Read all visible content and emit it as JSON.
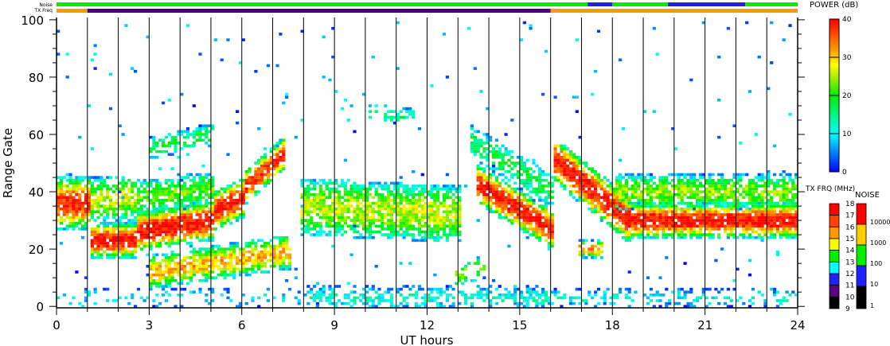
{
  "top_bars": {
    "noise_label": "Noise",
    "txfreq_label": "TX Freq",
    "noise_segments": [
      {
        "from": 0,
        "to": 17.2,
        "color": "#00ee00"
      },
      {
        "from": 17.2,
        "to": 18.0,
        "color": "#2020e0"
      },
      {
        "from": 18.0,
        "to": 19.8,
        "color": "#00ee00"
      },
      {
        "from": 19.8,
        "to": 22.3,
        "color": "#2020e0"
      },
      {
        "from": 22.3,
        "to": 24,
        "color": "#00ee00"
      }
    ],
    "txfreq_segments": [
      {
        "from": 0,
        "to": 1,
        "color": "#ff9900"
      },
      {
        "from": 1,
        "to": 16,
        "color": "#4b0082"
      },
      {
        "from": 16,
        "to": 24,
        "color": "#ff9900"
      }
    ]
  },
  "chart_data": {
    "type": "heatmap",
    "title": "",
    "xlabel": "UT hours",
    "ylabel": "Range Gate",
    "xlim": [
      0,
      24
    ],
    "ylim": [
      -0.5,
      100.8
    ],
    "xticks": [
      "0",
      "3",
      "6",
      "9",
      "12",
      "15",
      "18",
      "21",
      "24"
    ],
    "xtick_values": [
      0,
      3,
      6,
      9,
      12,
      15,
      18,
      21,
      24
    ],
    "yticks": [
      "0",
      "20",
      "40",
      "60",
      "80",
      "100"
    ],
    "ytick_values": [
      0,
      20,
      40,
      60,
      80,
      100
    ],
    "vertical_grid_hours": [
      1,
      2,
      3,
      4,
      5,
      6,
      7,
      8,
      9,
      10,
      11,
      12,
      13,
      14,
      15,
      16,
      17,
      18,
      19,
      20,
      21,
      22,
      23
    ],
    "value_label": "POWER (dB)",
    "value_range": [
      0,
      40
    ],
    "echo_regions": [
      {
        "hours": [
          0,
          1
        ],
        "gate_center": [
          36,
          36
        ],
        "half_width": 9,
        "peak_db": 38,
        "density": 0.95
      },
      {
        "hours": [
          1,
          2.6
        ],
        "gate_center": [
          23,
          23
        ],
        "half_width": 6,
        "peak_db": 40,
        "density": 0.95
      },
      {
        "hours": [
          1,
          2.6
        ],
        "gate_center": [
          37,
          38
        ],
        "half_width": 8,
        "peak_db": 26,
        "density": 0.8
      },
      {
        "hours": [
          2.6,
          5
        ],
        "gate_center": [
          26,
          30
        ],
        "half_width": 7,
        "peak_db": 40,
        "density": 0.95
      },
      {
        "hours": [
          2.6,
          5
        ],
        "gate_center": [
          38,
          41
        ],
        "half_width": 6,
        "peak_db": 22,
        "density": 0.8
      },
      {
        "hours": [
          5,
          6
        ],
        "gate_center": [
          33,
          38
        ],
        "half_width": 7,
        "peak_db": 39,
        "density": 0.95
      },
      {
        "hours": [
          6,
          7.3
        ],
        "gate_center": [
          41,
          53
        ],
        "half_width": 6,
        "peak_db": 38,
        "density": 0.9
      },
      {
        "hours": [
          3,
          7.5
        ],
        "gate_center": [
          12,
          19
        ],
        "half_width": 6,
        "peak_db": 31,
        "density": 0.85
      },
      {
        "hours": [
          3,
          5
        ],
        "gate_center": [
          55,
          60
        ],
        "half_width": 4,
        "peak_db": 18,
        "density": 0.55
      },
      {
        "hours": [
          7.8,
          13
        ],
        "gate_center": [
          35,
          32
        ],
        "half_width": 10,
        "peak_db": 26,
        "density": 0.85
      },
      {
        "hours": [
          10,
          11.5
        ],
        "gate_center": [
          68,
          66
        ],
        "half_width": 3,
        "peak_db": 15,
        "density": 0.4
      },
      {
        "hours": [
          12.8,
          13.8
        ],
        "gate_center": [
          10,
          14
        ],
        "half_width": 4,
        "peak_db": 24,
        "density": 0.5
      },
      {
        "hours": [
          13.5,
          16
        ],
        "gate_center": [
          43,
          27
        ],
        "half_width": 7,
        "peak_db": 40,
        "density": 0.95
      },
      {
        "hours": [
          13.3,
          16
        ],
        "gate_center": [
          58,
          40
        ],
        "half_width": 6,
        "peak_db": 18,
        "density": 0.7
      },
      {
        "hours": [
          16,
          18.5
        ],
        "gate_center": [
          52,
          30
        ],
        "half_width": 8,
        "peak_db": 40,
        "density": 0.95
      },
      {
        "hours": [
          16.8,
          17.6
        ],
        "gate_center": [
          20,
          20
        ],
        "half_width": 3,
        "peak_db": 32,
        "density": 0.8
      },
      {
        "hours": [
          18.5,
          24
        ],
        "gate_center": [
          30,
          30
        ],
        "half_width": 6,
        "peak_db": 40,
        "density": 0.95
      },
      {
        "hours": [
          18,
          24
        ],
        "gate_center": [
          40,
          40
        ],
        "half_width": 6,
        "peak_db": 24,
        "density": 0.85
      },
      {
        "hours": [
          8,
          16
        ],
        "gate_center": [
          3,
          3
        ],
        "half_width": 4,
        "peak_db": 12,
        "density": 0.5
      },
      {
        "hours": [
          16,
          24
        ],
        "gate_center": [
          3,
          3
        ],
        "half_width": 3,
        "peak_db": 11,
        "density": 0.3
      },
      {
        "hours": [
          0,
          8
        ],
        "gate_center": [
          3,
          3
        ],
        "half_width": 3,
        "peak_db": 10,
        "density": 0.2
      }
    ],
    "scatter_density": 0.01
  },
  "power_colorbar": {
    "title": "POWER (dB)",
    "labels": [
      "40",
      "30",
      "20",
      "10",
      "0"
    ]
  },
  "txfreq_colorbar": {
    "title": "TX FRQ (MHz)",
    "labels": [
      "18",
      "17",
      "16",
      "15",
      "14",
      "13",
      "12",
      "11",
      "10",
      "9"
    ],
    "colors": [
      "#ff0000",
      "#ff4400",
      "#ff9900",
      "#ffff00",
      "#00ee00",
      "#00ffff",
      "#2020ff",
      "#5a0080",
      "#000000"
    ]
  },
  "noise_colorbar": {
    "title": "NOISE",
    "labels": [
      "10000",
      "1000",
      "100",
      "10",
      "1"
    ],
    "colors": [
      "#ff0000",
      "#ffcc00",
      "#00ee00",
      "#2020ff",
      "#000000"
    ]
  }
}
